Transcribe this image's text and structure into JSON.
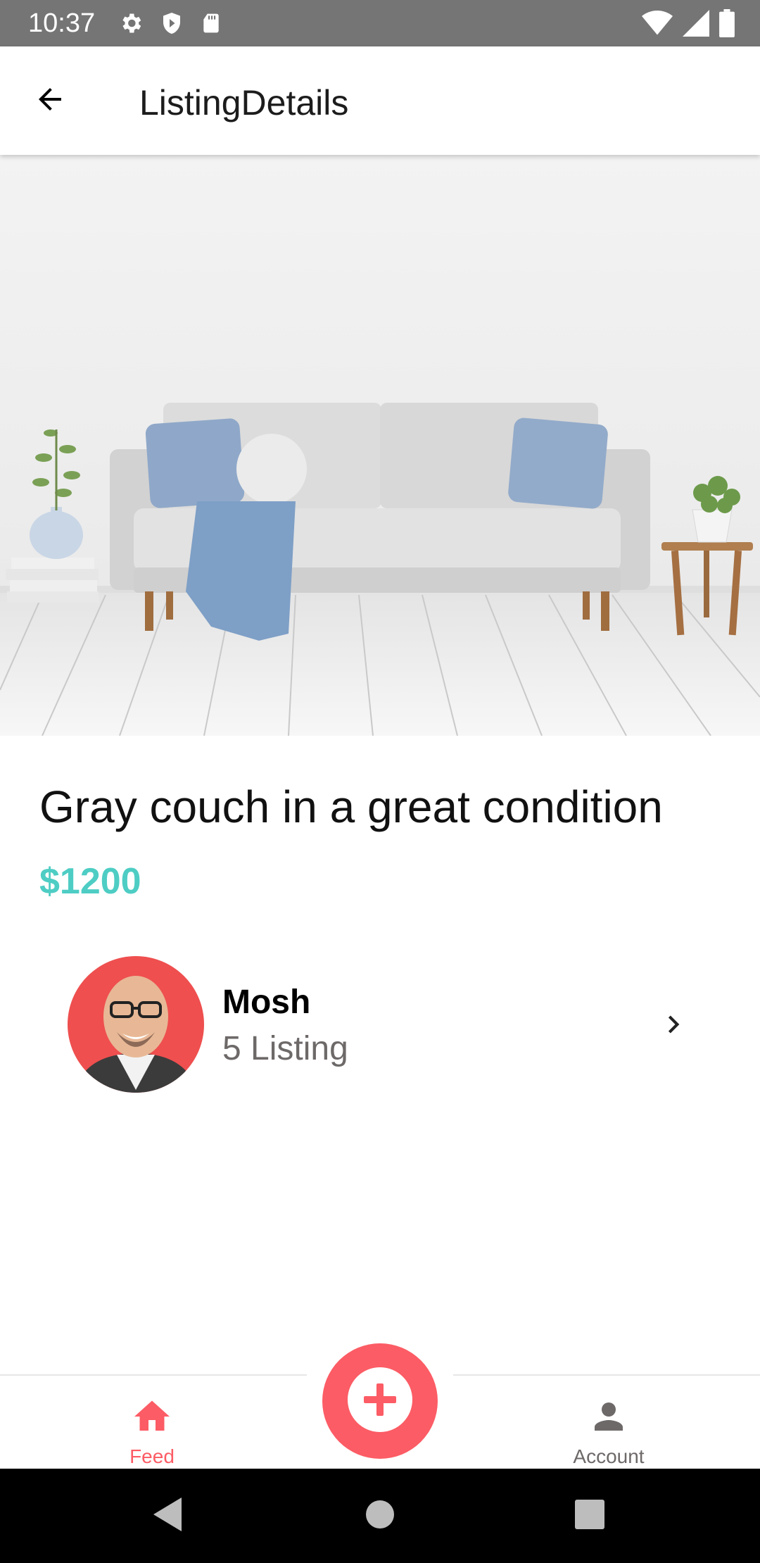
{
  "status_bar": {
    "time": "10:37",
    "left_icons": [
      "gear-icon",
      "shield-icon",
      "sd-card-icon"
    ],
    "right_icons": [
      "wifi-icon",
      "signal-icon",
      "battery-icon"
    ]
  },
  "app_bar": {
    "title": "ListingDetails",
    "back_icon": "arrow-left-icon"
  },
  "listing": {
    "image": "couch-photo",
    "title": "Gray couch in a great condition",
    "price": "$1200"
  },
  "seller": {
    "name": "Mosh",
    "listings": "5 Listing",
    "chevron_icon": "chevron-right-icon"
  },
  "tab_bar": {
    "feed_label": "Feed",
    "account_label": "Account",
    "active_color": "#fc5c65",
    "inactive_color": "#6e6969"
  },
  "colors": {
    "primary": "#fc5c65",
    "secondary": "#4ecdc4"
  },
  "nav_bar": {
    "icons": [
      "back-triangle-icon",
      "home-circle-icon",
      "recents-square-icon"
    ]
  }
}
